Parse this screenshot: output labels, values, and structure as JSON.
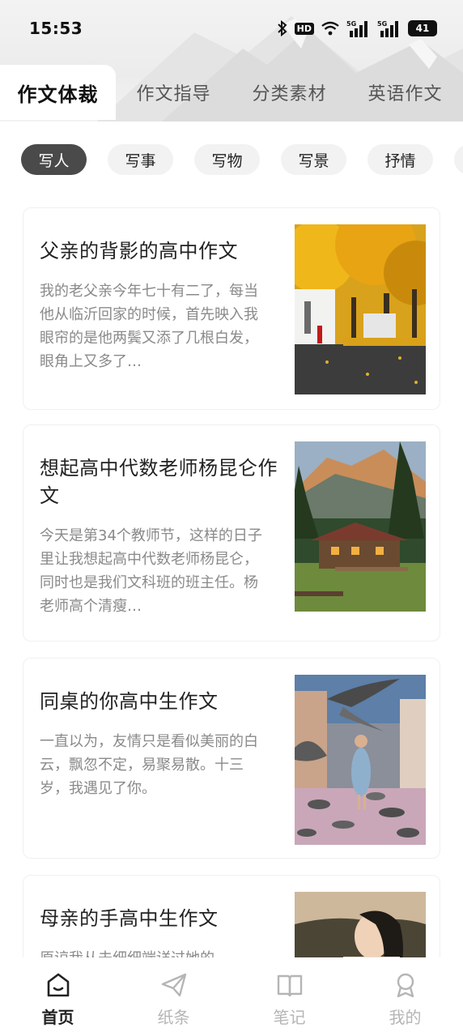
{
  "status_bar": {
    "time": "15:53",
    "hd_label": "HD",
    "battery_level": "41",
    "icons": [
      "bluetooth-icon",
      "hd-icon",
      "wifi-icon",
      "5g-signal-icon",
      "5g-signal-icon",
      "battery-icon"
    ]
  },
  "top_tabs": [
    {
      "label": "作文体裁",
      "active": true
    },
    {
      "label": "作文指导",
      "active": false
    },
    {
      "label": "分类素材",
      "active": false
    },
    {
      "label": "英语作文",
      "active": false
    }
  ],
  "chips": [
    {
      "label": "写人",
      "active": true
    },
    {
      "label": "写事",
      "active": false
    },
    {
      "label": "写物",
      "active": false
    },
    {
      "label": "写景",
      "active": false
    },
    {
      "label": "抒情",
      "active": false
    }
  ],
  "articles": [
    {
      "title": "父亲的背影的高中作文",
      "excerpt": "我的老父亲今年七十有二了，每当他从临沂回家的时候，首先映入我眼帘的是他两鬓又添了几根白发，眼角上又多了…",
      "image": "autumn-street-photo"
    },
    {
      "title": "想起高中代数老师杨昆仑作文",
      "excerpt": "今天是第34个教师节，这样的日子里让我想起高中代数老师杨昆仑，同时也是我们文科班的班主任。杨老师高个清瘦…",
      "image": "mountain-cabin-photo"
    },
    {
      "title": "同桌的你高中生作文",
      "excerpt": "一直以为，友情只是看似美丽的白云，飘忽不定，易聚易散。十三岁，我遇见了你。",
      "image": "pigeons-girl-photo"
    },
    {
      "title": "母亲的手高中生作文",
      "excerpt": "原谅我从未细细端详过她的",
      "image": "woman-portrait-photo"
    }
  ],
  "bottom_nav": [
    {
      "label": "首页",
      "icon": "home-icon",
      "active": true
    },
    {
      "label": "纸条",
      "icon": "paper-plane-icon",
      "active": false
    },
    {
      "label": "笔记",
      "icon": "book-icon",
      "active": false
    },
    {
      "label": "我的",
      "icon": "profile-icon",
      "active": false
    }
  ]
}
